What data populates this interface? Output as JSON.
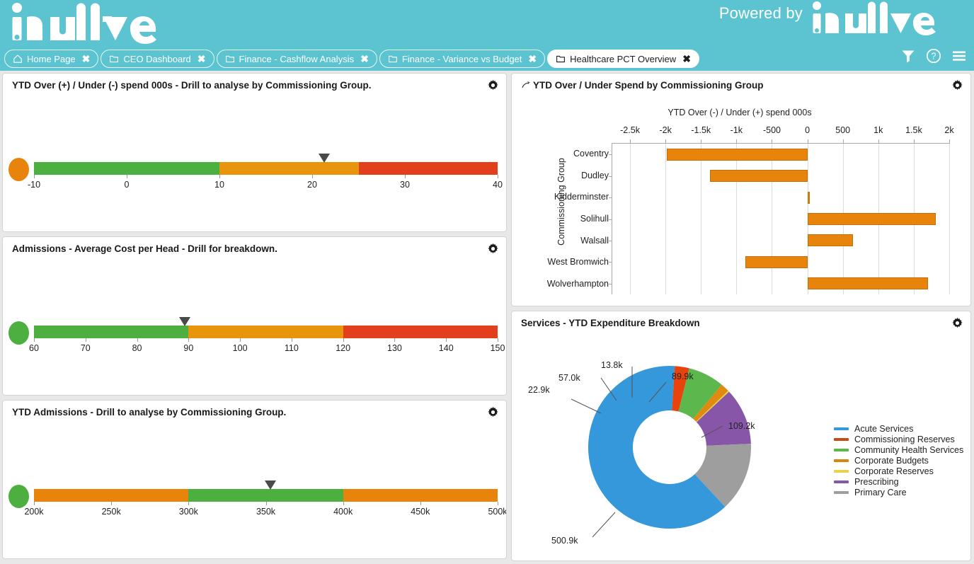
{
  "header": {
    "brand": "intuitive",
    "powered_by_text": "Powered by",
    "powered_by_brand": "intuitive",
    "background_color": "#5bc4d0",
    "tools": [
      {
        "name": "filter-icon",
        "label": "Filter"
      },
      {
        "name": "help-icon",
        "label": "Help"
      },
      {
        "name": "menu-icon",
        "label": "Menu"
      }
    ]
  },
  "tabs": [
    {
      "label": "Home Page",
      "icon": "home-icon",
      "active": false,
      "close": "✖"
    },
    {
      "label": "CEO Dashboard",
      "icon": "folder-icon",
      "active": false,
      "close": "✖"
    },
    {
      "label": "Finance - Cashflow Analysis",
      "icon": "folder-icon",
      "active": false,
      "close": "✖"
    },
    {
      "label": "Finance - Variance vs Budget",
      "icon": "folder-icon",
      "active": false,
      "close": "✖"
    },
    {
      "label": "Healthcare PCT Overview",
      "icon": "folder-icon",
      "active": true,
      "close": "✖"
    }
  ],
  "panels": {
    "kpi1": {
      "title": "YTD Over (+) / Under (-) spend 000s - Drill to analyse by Commissioning Group.",
      "gear": "gear-icon",
      "status_color": "#e8840c"
    },
    "kpi2": {
      "title": "Admissions - Average Cost per Head - Drill for breakdown.",
      "gear": "gear-icon",
      "status_color": "#4caf3f"
    },
    "kpi3": {
      "title": "YTD Admissions - Drill to analyse by Commissioning Group.",
      "gear": "gear-icon",
      "status_color": "#4caf3f"
    },
    "bar": {
      "title": "YTD Over / Under Spend by Commissioning Group",
      "gear": "gear-icon",
      "drill_icon": "drill-arrow-icon"
    },
    "donut": {
      "title": "Services - YTD Expenditure Breakdown",
      "gear": "gear-icon"
    }
  },
  "chart_data": [
    {
      "type": "bullet-gauge",
      "title": "YTD Over (+) / Under (-) spend 000s - Drill to analyse by Commissioning Group.",
      "xlim": [
        -10,
        40
      ],
      "tick_labels": [
        "-10",
        "0",
        "10",
        "20",
        "30",
        "40"
      ],
      "tick_values": [
        -10,
        0,
        10,
        20,
        30,
        40
      ],
      "marker_value": 21.3,
      "status": "amber",
      "bands": [
        {
          "from": -10,
          "to": 10,
          "color": "#4caf3f"
        },
        {
          "from": 10,
          "to": 25,
          "color": "#e8940c"
        },
        {
          "from": 25,
          "to": 40,
          "color": "#e2401c"
        }
      ]
    },
    {
      "type": "bullet-gauge",
      "title": "Admissions - Average Cost per Head - Drill for breakdown.",
      "xlim": [
        60,
        150
      ],
      "tick_labels": [
        "60",
        "70",
        "80",
        "90",
        "100",
        "110",
        "120",
        "130",
        "140",
        "150"
      ],
      "tick_values": [
        60,
        70,
        80,
        90,
        100,
        110,
        120,
        130,
        140,
        150
      ],
      "marker_value": 89.3,
      "status": "green",
      "bands": [
        {
          "from": 60,
          "to": 90,
          "color": "#4caf3f"
        },
        {
          "from": 90,
          "to": 120,
          "color": "#e8940c"
        },
        {
          "from": 120,
          "to": 150,
          "color": "#e2401c"
        }
      ]
    },
    {
      "type": "bullet-gauge",
      "title": "YTD Admissions - Drill to analyse by Commissioning Group.",
      "xlim": [
        200000,
        500000
      ],
      "tick_labels": [
        "200k",
        "250k",
        "300k",
        "350k",
        "400k",
        "450k",
        "500k"
      ],
      "tick_values": [
        200000,
        250000,
        300000,
        350000,
        400000,
        450000,
        500000
      ],
      "marker_value": 353000,
      "status": "green",
      "bands": [
        {
          "from": 200000,
          "to": 300000,
          "color": "#e8840c"
        },
        {
          "from": 300000,
          "to": 400000,
          "color": "#4caf3f"
        },
        {
          "from": 400000,
          "to": 500000,
          "color": "#e8840c"
        }
      ]
    },
    {
      "type": "bar",
      "orientation": "horizontal",
      "title": "YTD Over / Under Spend by Commissioning Group",
      "xlabel": "YTD Over (-) / Under (+) spend 000s",
      "ylabel": "Commissioning Group",
      "categories": [
        "Coventry",
        "Dudley",
        "Kidderminster",
        "Solihull",
        "Walsall",
        "West Bromwich",
        "Wolverhampton"
      ],
      "values": [
        -1980,
        -1370,
        30,
        1810,
        640,
        -870,
        1700
      ],
      "xlim": [
        -2750,
        2000
      ],
      "tick_values": [
        -2500,
        -2000,
        -1500,
        -1000,
        -500,
        0,
        500,
        1000,
        1500,
        2000
      ],
      "tick_labels": [
        "-2.5k",
        "-2k",
        "-1.5k",
        "-1k",
        "-500",
        "0",
        "500",
        "1k",
        "1.5k",
        "2k"
      ],
      "bar_color": "#e8840c",
      "grid": true,
      "legend": "none"
    },
    {
      "type": "pie",
      "variant": "donut",
      "title": "Services - YTD Expenditure Breakdown",
      "legend_position": "right",
      "labels": [
        "Acute Services",
        "Commissioning Reserves",
        "Community Health Services",
        "Corporate Budgets",
        "Corporate Reserves",
        "Prescribing",
        "Primary Care"
      ],
      "values": [
        500.9,
        22.9,
        57.0,
        13.8,
        2.0,
        89.9,
        109.2
      ],
      "value_labels": [
        "500.9k",
        "22.9k",
        "57.0k",
        "13.8k",
        "",
        "89.9k",
        "109.2k"
      ],
      "colors": [
        "#3498db",
        "#e8430c",
        "#5cb84c",
        "#e08a10",
        "#e8d44c",
        "#8856a8",
        "#9e9e9e"
      ],
      "units": "k"
    }
  ],
  "donut_legend": [
    {
      "label": "Acute Services",
      "color": "#3498db"
    },
    {
      "label": "Commissioning Reserves",
      "color": "#c94a12"
    },
    {
      "label": "Community Health Services",
      "color": "#5cb84c"
    },
    {
      "label": "Corporate Budgets",
      "color": "#d4860e"
    },
    {
      "label": "Corporate Reserves",
      "color": "#e8d44c"
    },
    {
      "label": "Prescribing",
      "color": "#8856a8"
    },
    {
      "label": "Primary Care",
      "color": "#9e9e9e"
    }
  ]
}
